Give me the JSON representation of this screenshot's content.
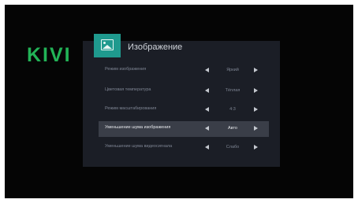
{
  "brand": {
    "logo_text": "KIVI",
    "color": "#22b357"
  },
  "panel": {
    "icon": "picture-icon",
    "title": "Изображение",
    "accent": "#1f9a8e"
  },
  "settings": [
    {
      "label": "Режим изображения",
      "value": "Яркий",
      "selected": false
    },
    {
      "label": "Цветовая температура",
      "value": "Тёплая",
      "selected": false
    },
    {
      "label": "Режим масштабирования",
      "value": "4:3",
      "selected": false
    },
    {
      "label": "Уменьшение шума изображения",
      "value": "Авто",
      "selected": true
    },
    {
      "label": "Уменьшение шума видеосигнала",
      "value": "Слабо",
      "selected": false
    }
  ]
}
